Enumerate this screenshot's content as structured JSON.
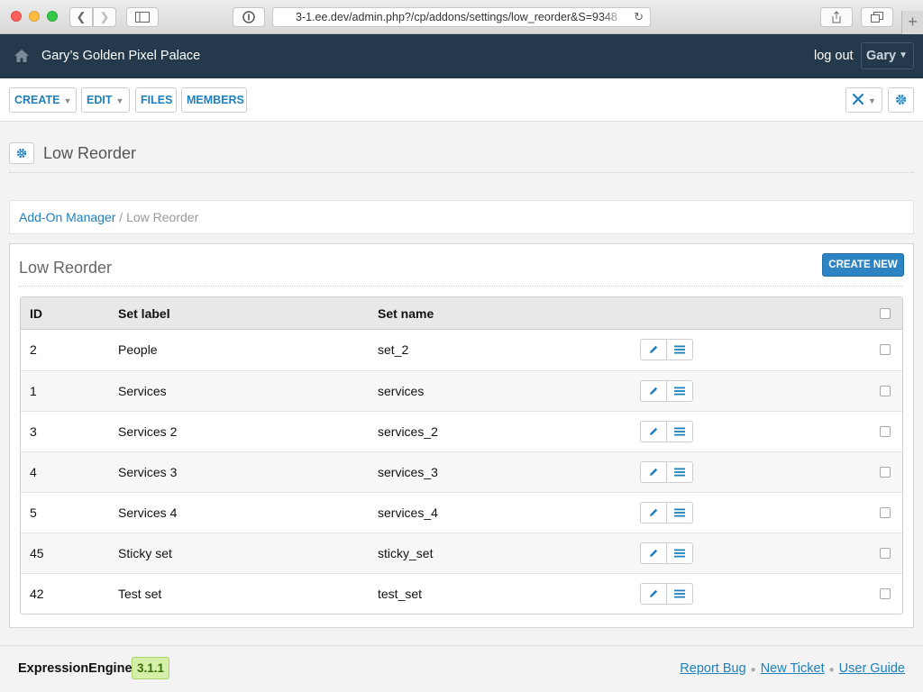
{
  "browser": {
    "url": "3-1.ee.dev/admin.php?/cp/addons/settings/low_reorder&S=9348",
    "plus": "+"
  },
  "header": {
    "site_name": "Gary’s Golden Pixel Palace",
    "logout": "log out",
    "user": "Gary"
  },
  "toolbar": {
    "create": "CREATE",
    "edit": "EDIT",
    "files": "FILES",
    "members": "MEMBERS"
  },
  "page": {
    "title": "Low Reorder"
  },
  "breadcrumb": {
    "parent": "Add-On Manager",
    "separator": "/",
    "current": "Low Reorder"
  },
  "box": {
    "title": "Low Reorder",
    "create_new": "CREATE NEW"
  },
  "table": {
    "headers": {
      "id": "ID",
      "label": "Set label",
      "name": "Set name"
    },
    "rows": [
      {
        "id": "2",
        "label": "People",
        "name": "set_2"
      },
      {
        "id": "1",
        "label": "Services",
        "name": "services"
      },
      {
        "id": "3",
        "label": "Services 2",
        "name": "services_2"
      },
      {
        "id": "4",
        "label": "Services 3",
        "name": "services_3"
      },
      {
        "id": "5",
        "label": "Services 4",
        "name": "services_4"
      },
      {
        "id": "45",
        "label": "Sticky set",
        "name": "sticky_set"
      },
      {
        "id": "42",
        "label": "Test set",
        "name": "test_set"
      }
    ]
  },
  "footer": {
    "product": "ExpressionEngine",
    "version": "3.1.1",
    "links": [
      "Report Bug",
      "New Ticket",
      "User Guide"
    ]
  },
  "colors": {
    "header_bg": "#24394b",
    "link": "#1f80bd",
    "primary_button": "#2e84c2"
  }
}
